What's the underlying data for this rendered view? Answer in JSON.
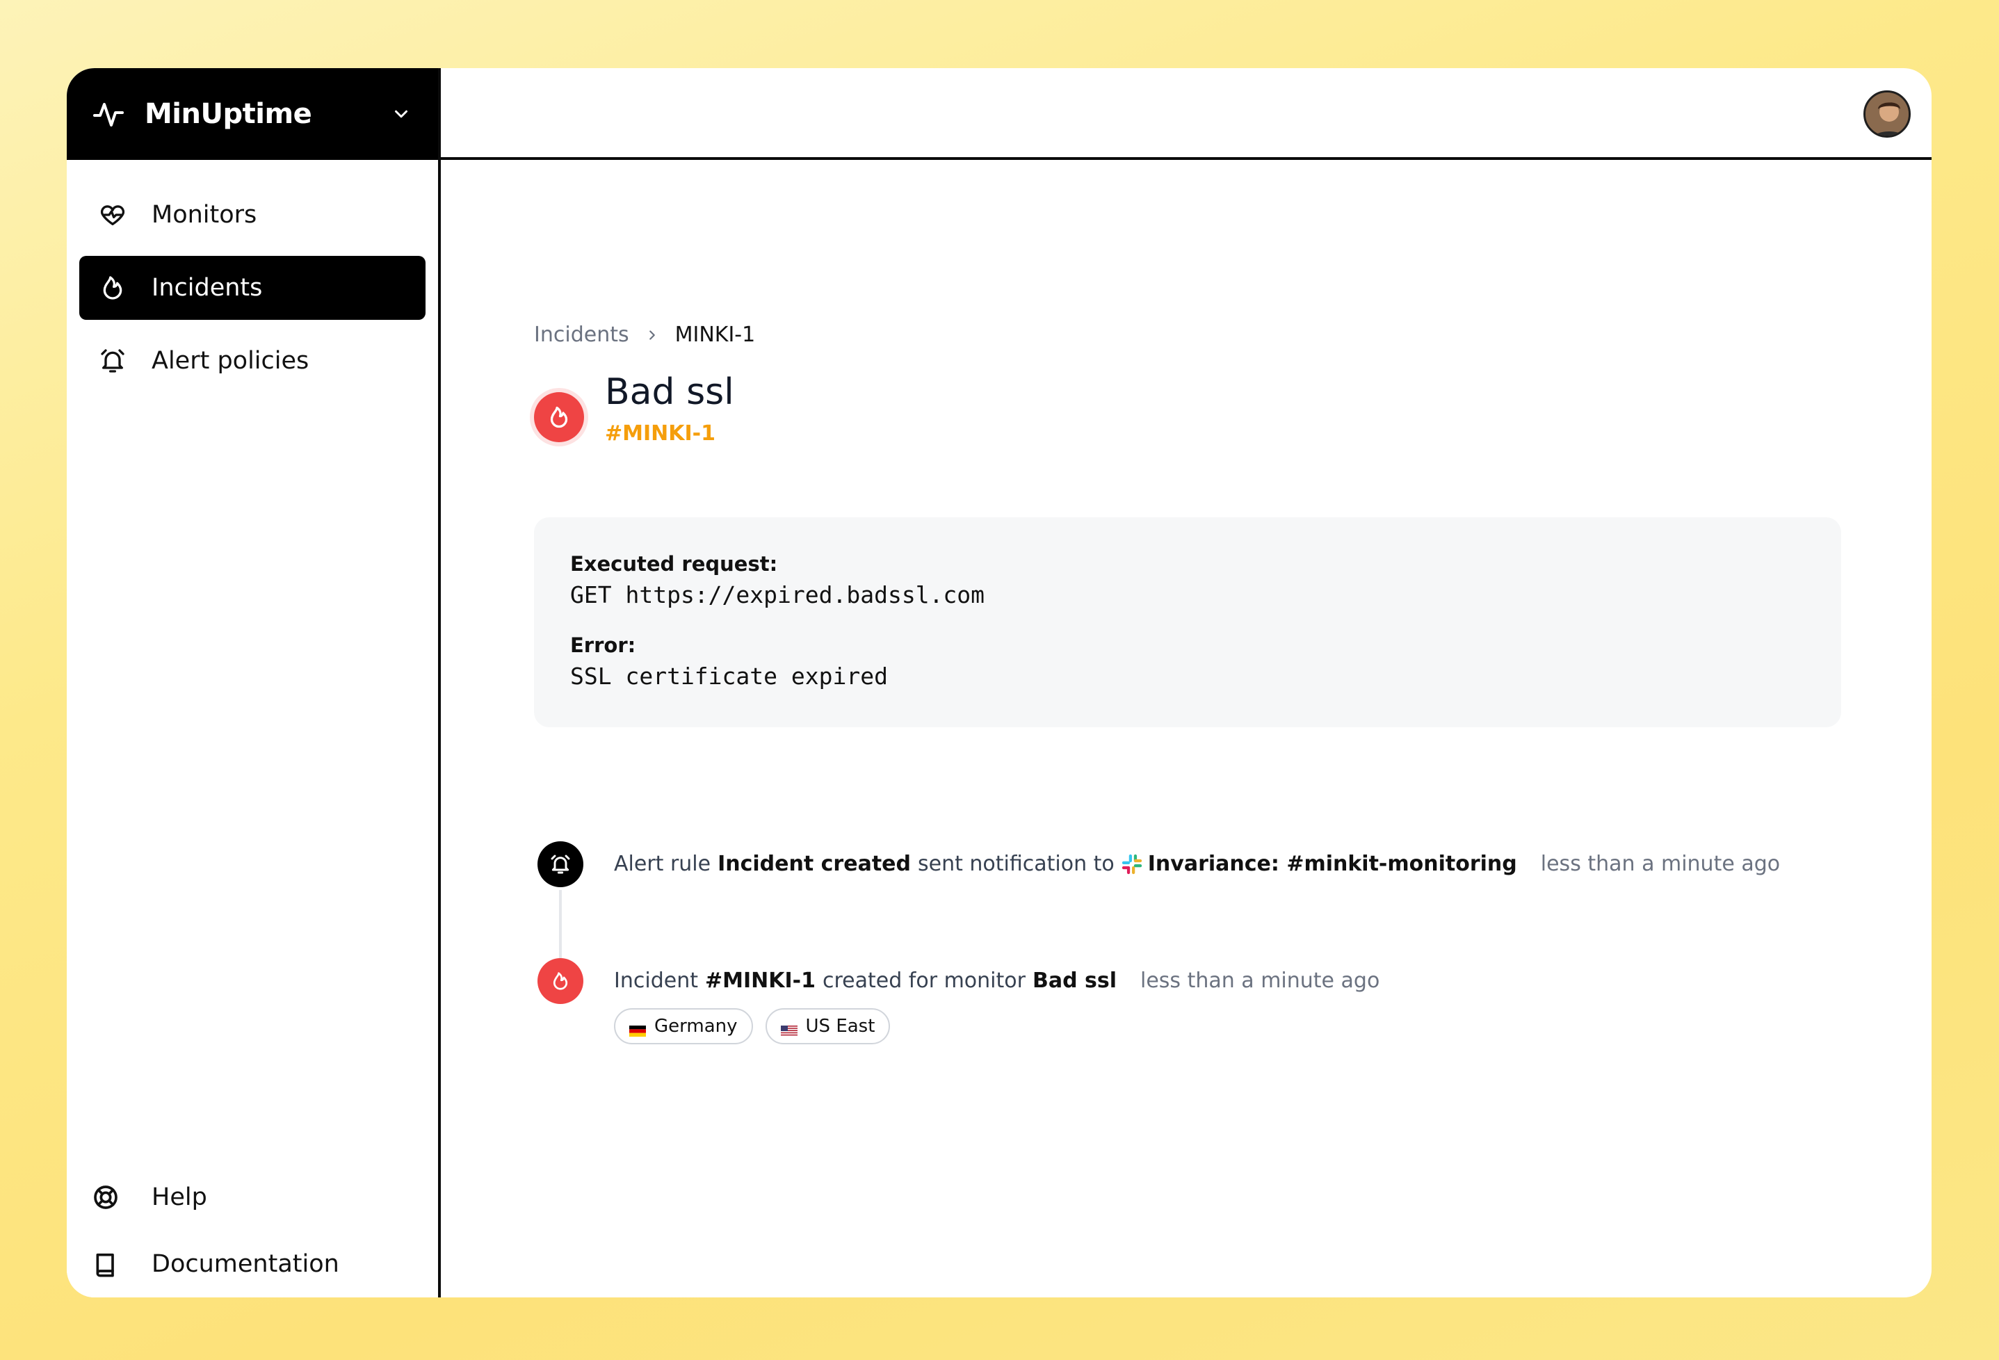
{
  "app": {
    "name": "MinUptime"
  },
  "sidebar": {
    "items": [
      {
        "label": "Monitors",
        "icon": "heart-pulse-icon",
        "active": false
      },
      {
        "label": "Incidents",
        "icon": "flame-icon",
        "active": true
      },
      {
        "label": "Alert policies",
        "icon": "alarm-bell-icon",
        "active": false
      }
    ],
    "bottom": [
      {
        "label": "Help",
        "icon": "life-buoy-icon"
      },
      {
        "label": "Documentation",
        "icon": "book-icon"
      }
    ]
  },
  "breadcrumb": {
    "parent": "Incidents",
    "current": "MINKI-1"
  },
  "incident": {
    "title": "Bad ssl",
    "code": "#MINKI-1"
  },
  "details": {
    "request_label": "Executed request:",
    "request_value": "GET https://expired.badssl.com",
    "error_label": "Error:",
    "error_value": "SSL certificate expired"
  },
  "timeline": [
    {
      "prefix": "Alert rule",
      "rule": "Incident created",
      "middle": "sent notification to",
      "target": "Invariance: #minkit-monitoring",
      "time": "less than a minute ago"
    },
    {
      "prefix": "Incident",
      "code": "#MINKI-1",
      "middle": "created for monitor",
      "monitor": "Bad ssl",
      "time": "less than a minute ago",
      "regions": [
        "Germany",
        "US East"
      ]
    }
  ],
  "colors": {
    "accent": "#f59e0b",
    "danger": "#ef4444",
    "sidebar_active": "#000000"
  }
}
